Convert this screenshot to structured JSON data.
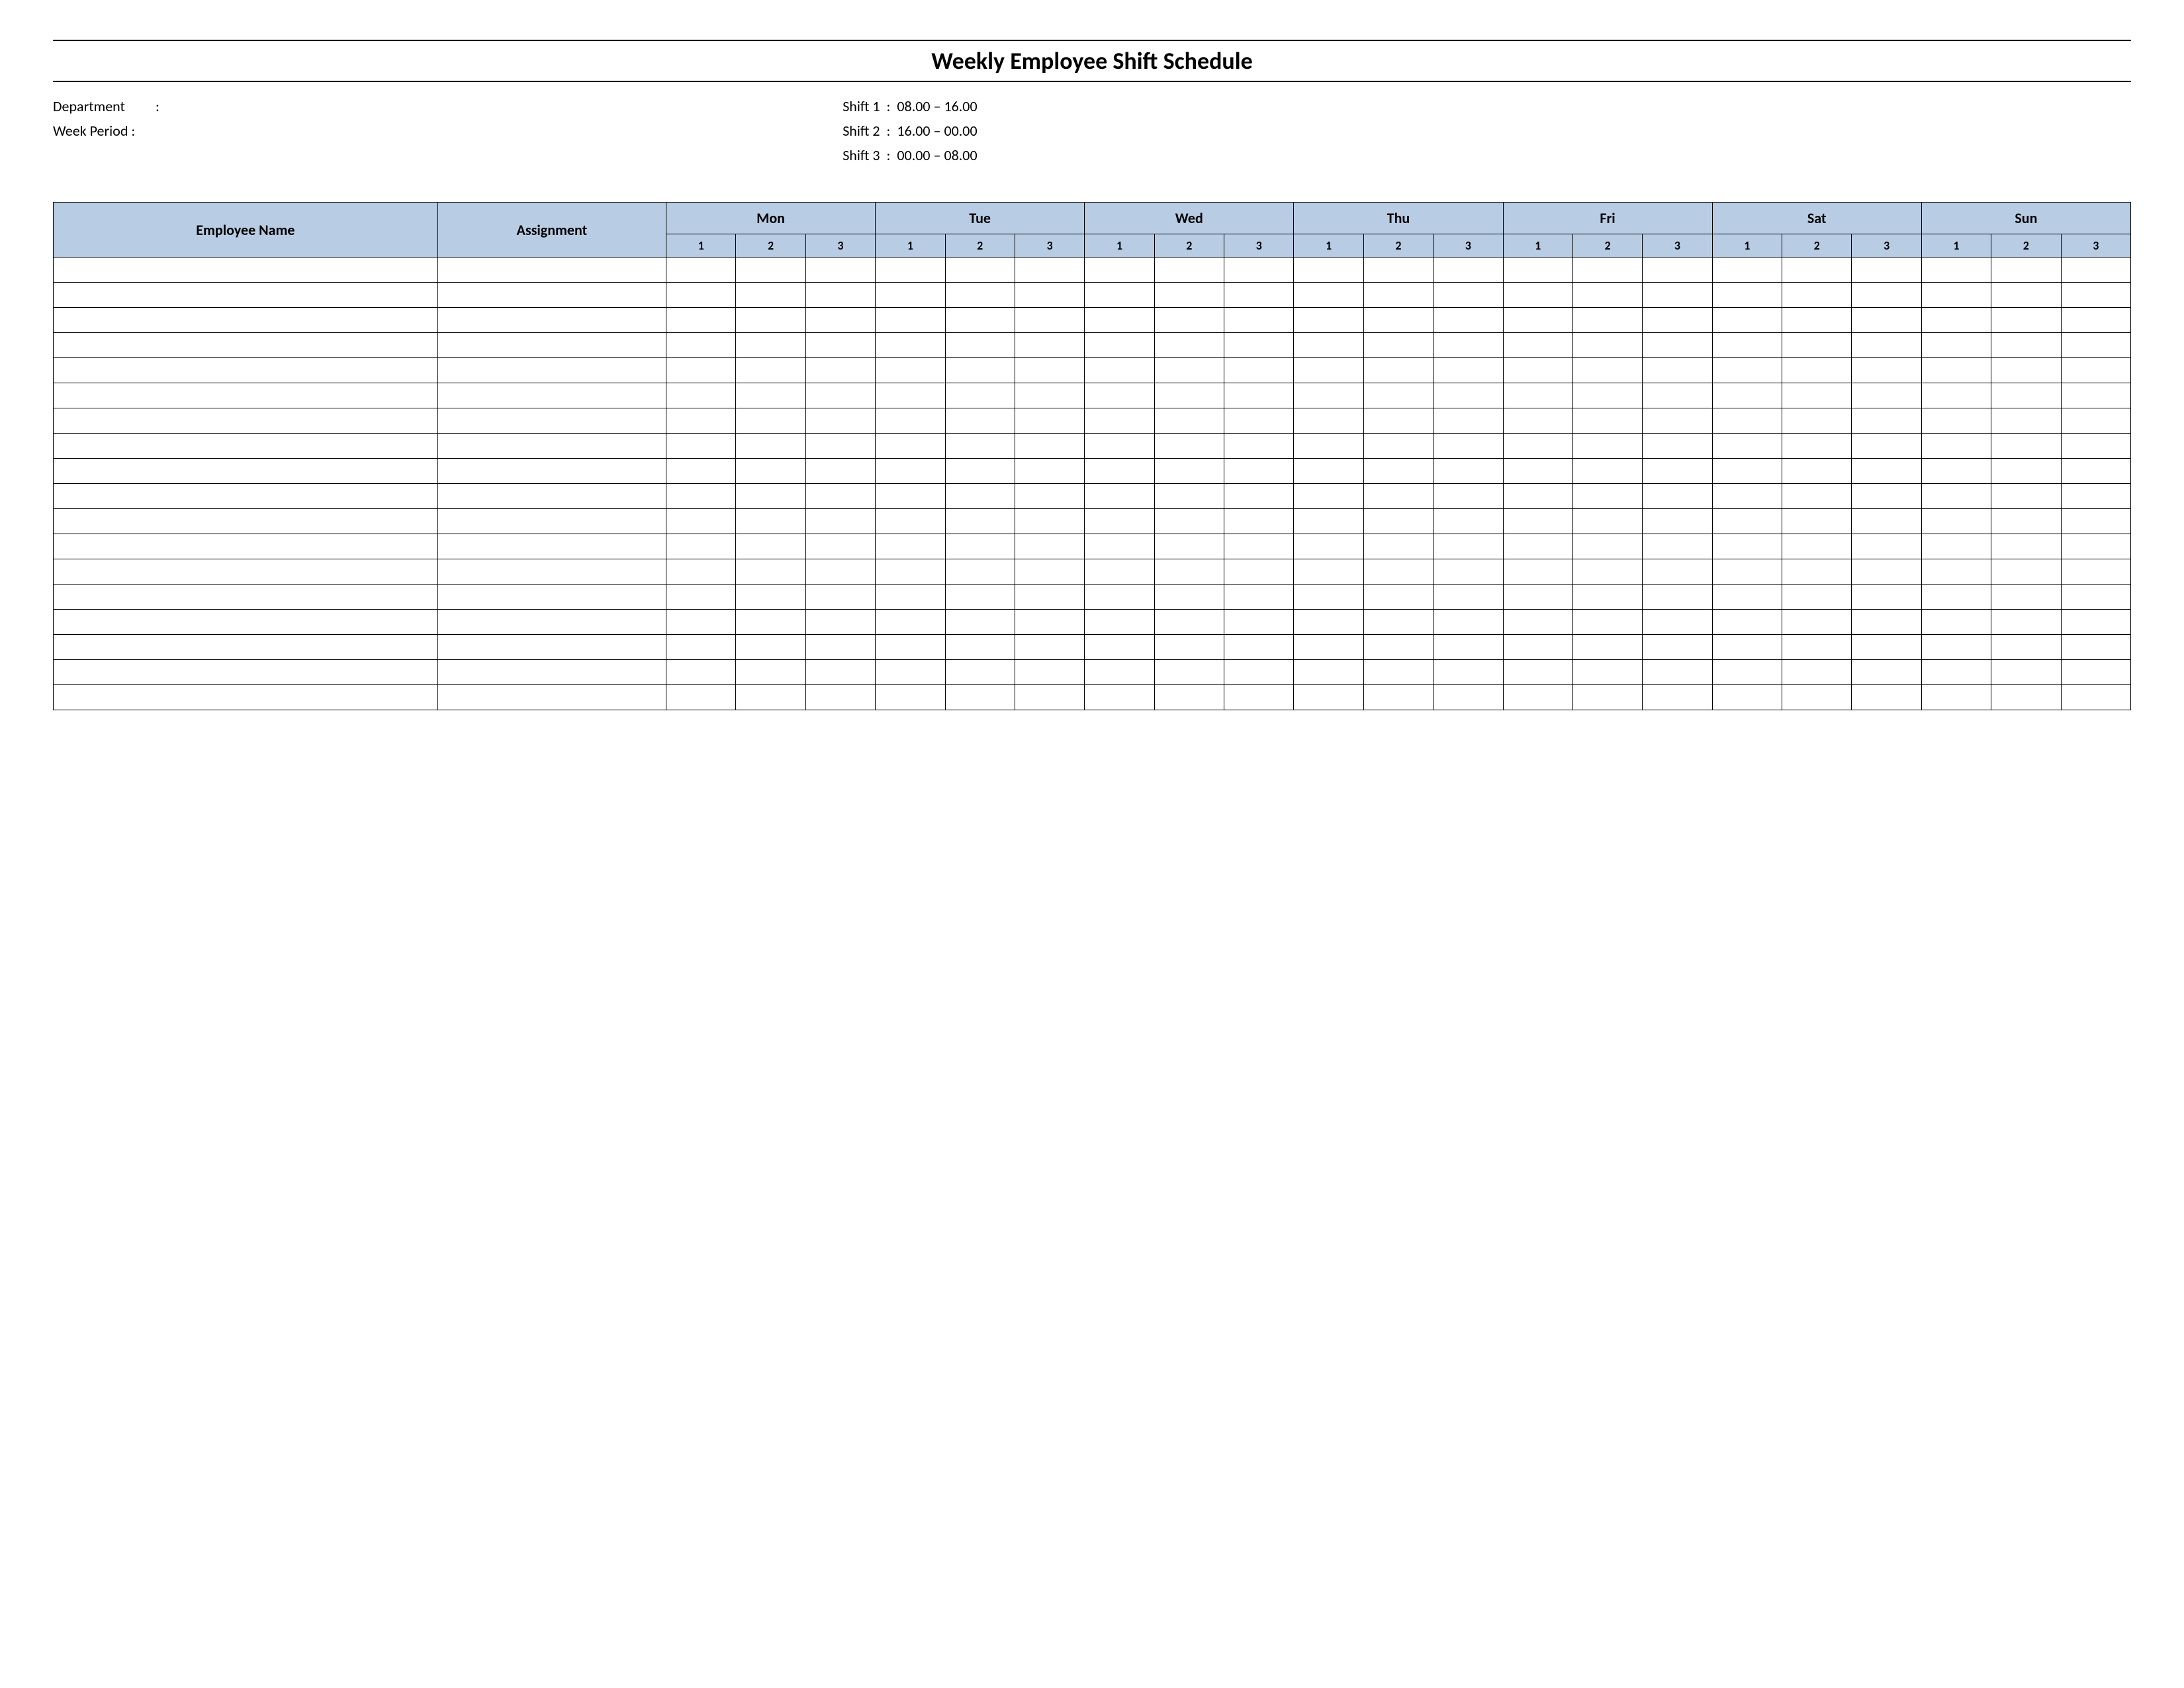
{
  "title": "Weekly Employee Shift Schedule",
  "meta": {
    "department_label": "Department",
    "department_value": "",
    "week_period_label": "Week  Period :",
    "week_period_value": "",
    "shift1_label": "Shift 1",
    "shift1_value": "08.00  – 16.00",
    "shift2_label": "Shift 2",
    "shift2_value": "16.00  – 00.00",
    "shift3_label": "Shift 3",
    "shift3_value": "00.00  – 08.00"
  },
  "headers": {
    "employee_name": "Employee Name",
    "assignment": "Assignment",
    "days": [
      "Mon",
      "Tue",
      "Wed",
      "Thu",
      "Fri",
      "Sat",
      "Sun"
    ],
    "shift_numbers": [
      "1",
      "2",
      "3"
    ]
  },
  "rows": 18
}
